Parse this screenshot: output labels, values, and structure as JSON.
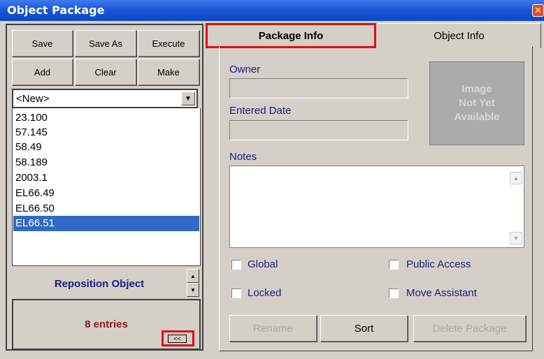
{
  "window": {
    "title": "Object Package",
    "close_glyph": "✕"
  },
  "left": {
    "buttons": {
      "save": "Save",
      "save_as": "Save As",
      "execute": "Execute",
      "add": "Add",
      "clear": "Clear",
      "make": "Make"
    },
    "package_select": {
      "value": "<New>",
      "arrow": "▼"
    },
    "packages": [
      {
        "label": "23.100"
      },
      {
        "label": "57.145"
      },
      {
        "label": "58.49"
      },
      {
        "label": "58.189"
      },
      {
        "label": "2003.1"
      },
      {
        "label": "EL66.49"
      },
      {
        "label": "EL66.50"
      },
      {
        "label": "EL66.51"
      }
    ],
    "selected_package": "EL66.51",
    "reposition_label": "Reposition Object",
    "spin_up": "▲",
    "spin_down": "▼",
    "entries_text": "8 entries",
    "collapse_label": "<<"
  },
  "tabs": {
    "package_info": "Package Info",
    "object_info": "Object Info",
    "active": "package_info"
  },
  "package_info": {
    "owner_label": "Owner",
    "owner_value": "",
    "entered_date_label": "Entered Date",
    "entered_date_value": "",
    "image_placeholder": [
      "Image",
      "Not Yet",
      "Available"
    ],
    "notes_label": "Notes",
    "notes_value": "",
    "scroll_up": "▲",
    "scroll_down": "▼",
    "checkboxes": {
      "global": {
        "label": "Global",
        "checked": false
      },
      "public_access": {
        "label": "Public Access",
        "checked": false
      },
      "locked": {
        "label": "Locked",
        "checked": false
      },
      "move_assistant": {
        "label": "Move Assistant",
        "checked": false
      }
    },
    "buttons": {
      "rename": "Rename",
      "sort": "Sort",
      "delete_package": "Delete Package"
    }
  },
  "colors": {
    "titlebar": "#1957d8",
    "selection": "#316ac5",
    "highlight_outline": "#e01010",
    "label_text": "#1c1c80",
    "entries_text": "#8b1a1a"
  }
}
